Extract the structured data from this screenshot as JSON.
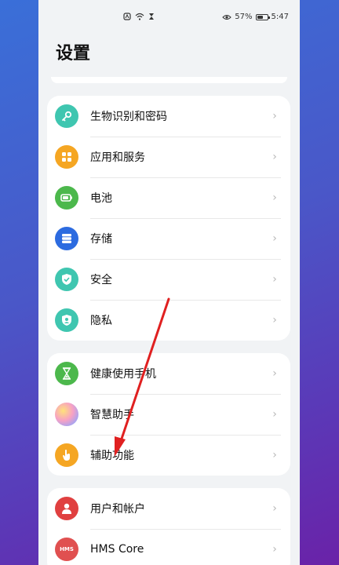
{
  "status_bar": {
    "nfc_icon": "nfc-icon",
    "wifi_icon": "wifi-icon",
    "hourglass_icon": "hourglass-icon",
    "eye_icon": "eye-icon",
    "battery_percent": "57%",
    "time": "5:47"
  },
  "page": {
    "title": "设置"
  },
  "groups": [
    {
      "items": [
        {
          "label": "生物识别和密码",
          "icon": "key-icon",
          "color": "#3fc6b0"
        },
        {
          "label": "应用和服务",
          "icon": "apps-icon",
          "color": "#f5a623"
        },
        {
          "label": "电池",
          "icon": "battery-icon",
          "color": "#4cb84c"
        },
        {
          "label": "存储",
          "icon": "storage-icon",
          "color": "#2c6be0"
        },
        {
          "label": "安全",
          "icon": "shield-check-icon",
          "color": "#3fc6b0"
        },
        {
          "label": "隐私",
          "icon": "privacy-icon",
          "color": "#3fc6b0"
        }
      ]
    },
    {
      "items": [
        {
          "label": "健康使用手机",
          "icon": "hourglass-icon",
          "color": "#4cb84c"
        },
        {
          "label": "智慧助手",
          "icon": "assistant-orb-icon",
          "color": "#e07bb8"
        },
        {
          "label": "辅助功能",
          "icon": "hand-icon",
          "color": "#f5a623"
        }
      ]
    },
    {
      "items": [
        {
          "label": "用户和帐户",
          "icon": "user-icon",
          "color": "#e04040"
        },
        {
          "label": "HMS Core",
          "icon": "hms-icon",
          "color": "#e05050"
        }
      ]
    }
  ],
  "annotation": {
    "arrow_color": "#e02020"
  }
}
